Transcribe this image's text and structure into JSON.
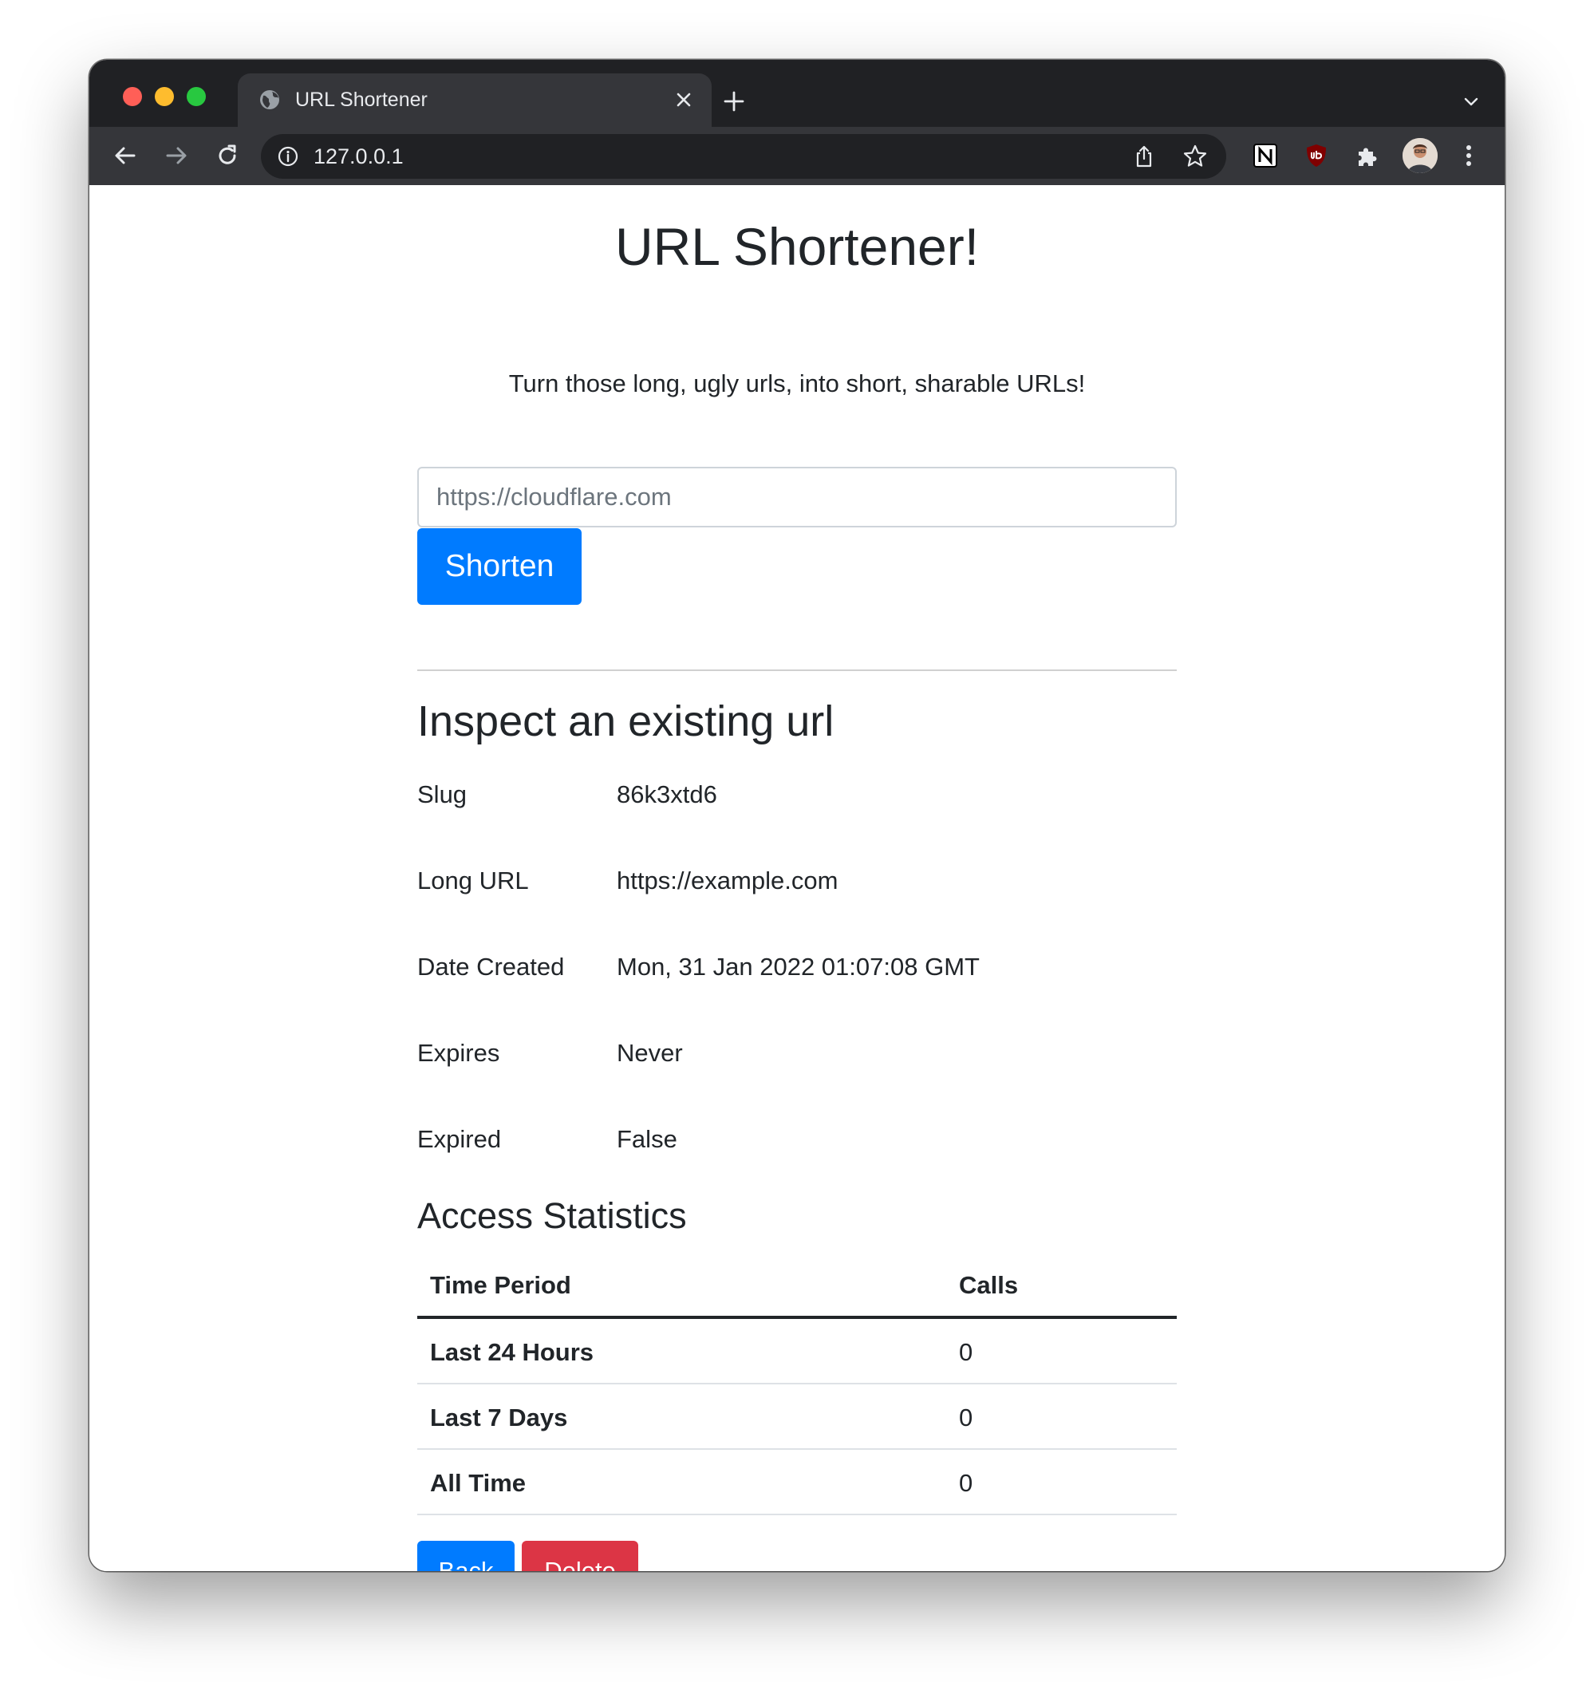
{
  "browser": {
    "tab_title": "URL Shortener",
    "address": "127.0.0.1"
  },
  "page": {
    "heading": "URL Shortener!",
    "lead": "Turn those long, ugly urls, into short, sharable URLs!",
    "form": {
      "placeholder": "https://cloudflare.com",
      "value": "",
      "submit_label": "Shorten"
    },
    "inspect": {
      "heading": "Inspect an existing url",
      "fields": [
        {
          "label": "Slug",
          "value": "86k3xtd6"
        },
        {
          "label": "Long URL",
          "value": "https://example.com"
        },
        {
          "label": "Date Created",
          "value": "Mon, 31 Jan 2022 01:07:08 GMT"
        },
        {
          "label": "Expires",
          "value": "Never"
        },
        {
          "label": "Expired",
          "value": "False"
        }
      ]
    },
    "stats": {
      "heading": "Access Statistics",
      "columns": [
        "Time Period",
        "Calls"
      ],
      "rows": [
        {
          "period": "Last 24 Hours",
          "calls": "0"
        },
        {
          "period": "Last 7 Days",
          "calls": "0"
        },
        {
          "period": "All Time",
          "calls": "0"
        }
      ]
    },
    "actions": {
      "back_label": "Back",
      "delete_label": "Delete"
    }
  },
  "colors": {
    "primary": "#007bff",
    "danger": "#dc3545",
    "text": "#212529",
    "browser_dark": "#202124",
    "browser_toolbar": "#35363a"
  }
}
